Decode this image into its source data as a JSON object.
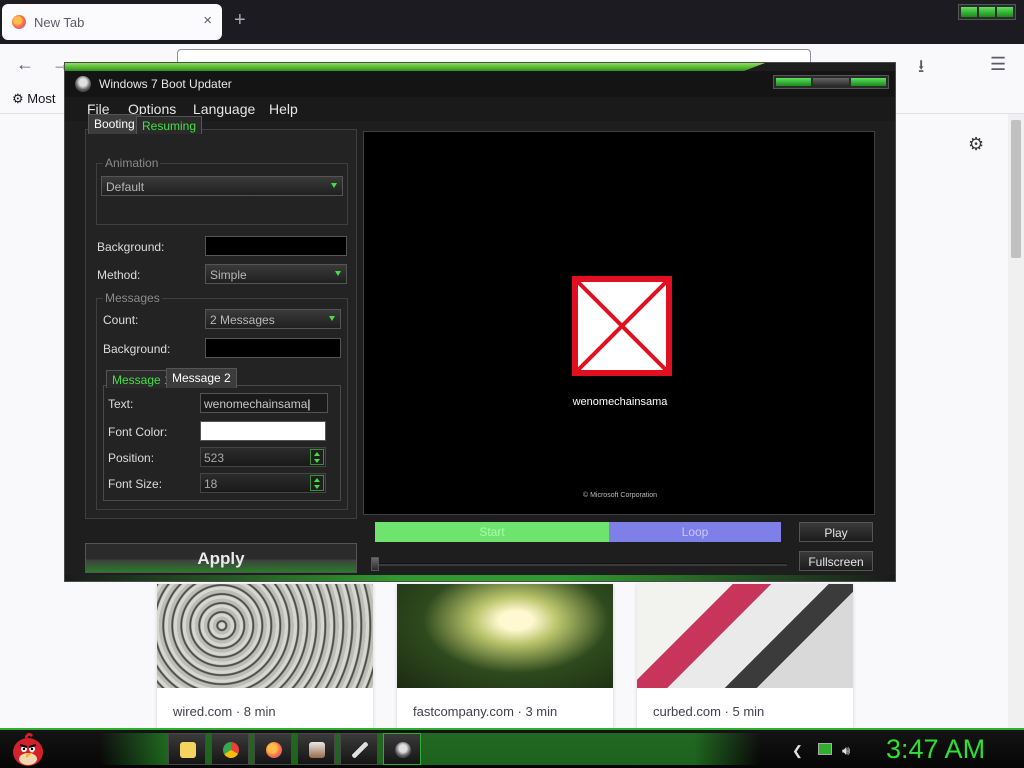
{
  "browser": {
    "tab_title": "New Tab",
    "tab_close": "×",
    "new_tab": "+",
    "bookmarks_label": "Most",
    "cards": [
      {
        "source": "wired.com · 8 min"
      },
      {
        "source": "fastcompany.com · 3 min"
      },
      {
        "source": "curbed.com · 5 min"
      }
    ]
  },
  "app": {
    "title": "Windows 7 Boot Updater",
    "menu": [
      "File",
      "Options",
      "Language",
      "Help"
    ],
    "tabs": {
      "booting": "Booting",
      "resuming": "Resuming"
    },
    "animation_group": "Animation",
    "animation_value": "Default",
    "background_label": "Background:",
    "method_label": "Method:",
    "method_value": "Simple",
    "messages_group": "Messages",
    "count_label": "Count:",
    "count_value": "2 Messages",
    "msg_background_label": "Background:",
    "msg_tabs": {
      "m1": "Message 1",
      "m2": "Message 2"
    },
    "text_label": "Text:",
    "text_value": "wenomechainsama",
    "font_color_label": "Font Color:",
    "position_label": "Position:",
    "position_value": "523",
    "font_size_label": "Font Size:",
    "font_size_value": "18",
    "apply": "Apply",
    "preview_text": "wenomechainsama",
    "preview_copyright": "© Microsoft Corporation",
    "progress_start": "Start",
    "progress_loop": "Loop",
    "play": "Play",
    "fullscreen": "Fullscreen",
    "colors": {
      "accent": "#43e043",
      "background_swatch": "#000000",
      "font_color_swatch": "#ffffff"
    }
  },
  "taskbar": {
    "clock": "3:47 AM",
    "items": [
      "file-explorer-icon",
      "chrome-icon",
      "firefox-icon",
      "media-icon",
      "pen-icon",
      "boot-updater-icon"
    ]
  }
}
